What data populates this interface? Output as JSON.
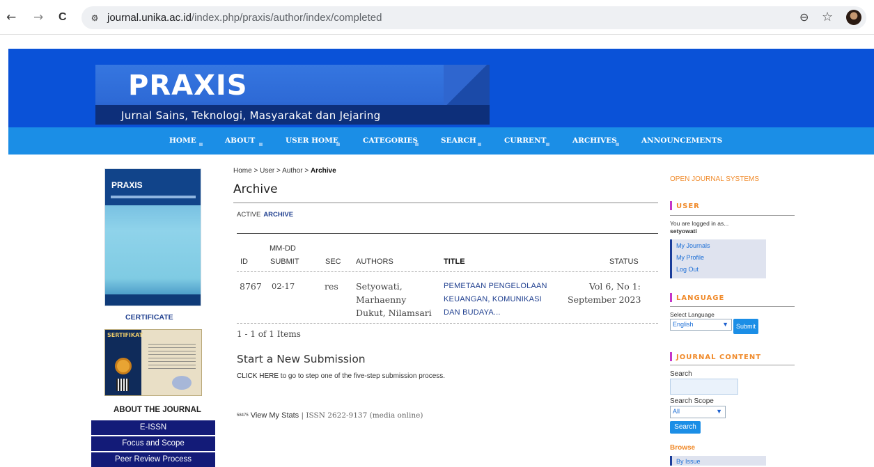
{
  "browser": {
    "url_domain": "journal.unika.ac.id",
    "url_path": "/index.php/praxis/author/index/completed",
    "back_icon": "←",
    "forward_icon": "→",
    "reload_icon": "C",
    "site_info_icon": "⚙",
    "zoom_icon": "⊖",
    "star_icon": "☆"
  },
  "header": {
    "title": "PRAXIS",
    "subtitle": "Jurnal Sains, Teknologi, Masyarakat dan Jejaring"
  },
  "menu": [
    "HOME",
    "ABOUT",
    "USER HOME",
    "CATEGORIES",
    "SEARCH",
    "CURRENT",
    "ARCHIVES",
    "ANNOUNCEMENTS"
  ],
  "left": {
    "cover_title": "PRAXIS",
    "certificate_link": "CERTIFICATE",
    "cert_label": "SERTIFIKAT",
    "about_title": "ABOUT THE JOURNAL",
    "about_items": [
      "E-ISSN",
      "Focus and Scope",
      "Peer Review Process"
    ]
  },
  "main": {
    "breadcrumb": {
      "home": "Home",
      "sep": " > ",
      "user": "User",
      "author": "Author",
      "current": "Archive"
    },
    "heading": "Archive",
    "tabs": {
      "active": "ACTIVE",
      "archive": "ARCHIVE"
    },
    "table": {
      "headers": {
        "id": "ID",
        "mmdd": "MM-DD",
        "submit": "SUBMIT",
        "sec": "SEC",
        "authors": "AUTHORS",
        "title": "TITLE",
        "status": "STATUS"
      },
      "rows": [
        {
          "id": "8767",
          "submit": "02-17",
          "sec": "res",
          "authors": [
            "Setyowati,",
            "Marhaenny",
            "Dukut, Nilamsari"
          ],
          "title": [
            "PEMETAAN PENGELOLAAN",
            "KEUANGAN, KOMUNIKASI",
            "DAN BUDAYA..."
          ],
          "status": [
            "Vol 6, No 1:",
            "September 2023"
          ]
        }
      ]
    },
    "items_count": "1 - 1 of 1 Items",
    "new_heading": "Start a New Submission",
    "new_click": "CLICK HERE",
    "new_text": " to go to step one of the five-step submission process.",
    "stats_count": "58475",
    "stats_link": "View My Stats",
    "issn": " | ISSN 2622-9137 (media online)"
  },
  "right": {
    "ojs": "OPEN JOURNAL SYSTEMS",
    "user_title": "USER",
    "logged_in_as": "You are logged in as...",
    "username": "setyowati",
    "user_links": [
      "My Journals",
      "My Profile",
      "Log Out"
    ],
    "language_title": "LANGUAGE",
    "select_language": "Select Language",
    "language_value": "English",
    "submit_label": "Submit",
    "journal_content_title": "JOURNAL CONTENT",
    "search_label": "Search",
    "search_scope_label": "Search Scope",
    "scope_value": "All",
    "search_button": "Search",
    "browse_label": "Browse",
    "by_issue": "By Issue"
  },
  "colors": {
    "header_blue": "#0a52d8",
    "menu_blue": "#1b8ee6",
    "accent_orange": "#f08a2a",
    "link_blue": "#1f3f8f",
    "about_navy": "#131b78"
  }
}
